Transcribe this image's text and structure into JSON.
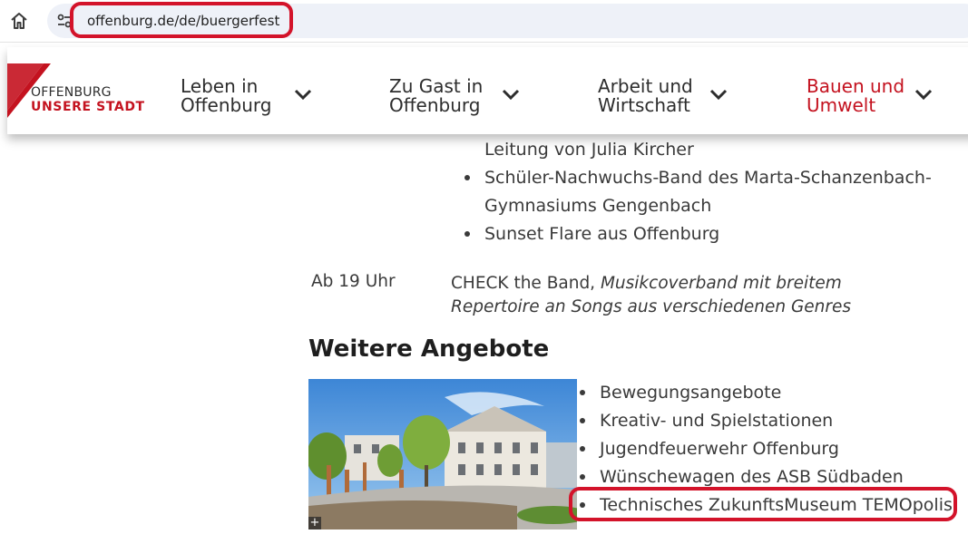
{
  "browser": {
    "url": "offenburg.de/de/buergerfest",
    "home_icon": "home-icon",
    "site_info_icon": "tune-icon"
  },
  "header": {
    "logo": {
      "line1": "OFFENBURG",
      "line2": "UNSERE STADT",
      "brand_color": "#c4121f"
    },
    "nav": [
      {
        "line1": "Leben in",
        "line2": "Offenburg"
      },
      {
        "line1": "Zu Gast in",
        "line2": "Offenburg"
      },
      {
        "line1": "Arbeit und",
        "line2": "Wirtschaft"
      },
      {
        "line1": "Bauen und",
        "line2": "Umwelt",
        "active": true
      }
    ]
  },
  "program": {
    "bands": [
      "Leitung von Julia Kircher",
      "Schüler-Nachwuchs-Band des Marta-Schanzenbach-",
      "Gymnasiums Gengenbach",
      "Sunset Flare aus Offenburg"
    ],
    "schedule": {
      "time": "Ab 19 Uhr",
      "act": "CHECK the Band,",
      "description": "Musikcoverband mit breitem Repertoire an Songs aus verschiedenen Genres"
    }
  },
  "weitere": {
    "heading": "Weitere Angebote",
    "image_expand": "+",
    "items": [
      "Bewegungsangebote",
      "Kreativ- und Spielstationen",
      "Jugendfeuerwehr Offenburg",
      "Wünschewagen des ASB Südbaden",
      "Technisches ZukunftsMuseum TEMOpolis"
    ]
  },
  "annotation_color": "#d3132a"
}
